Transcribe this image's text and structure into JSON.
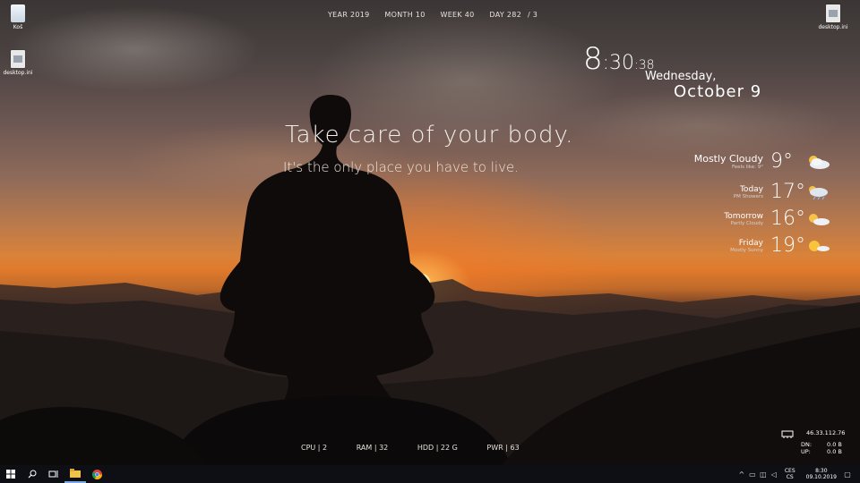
{
  "desktop": {
    "icons_left": [
      {
        "label": "Koš",
        "icon": "recycle-bin-icon"
      },
      {
        "label": "desktop.ini",
        "icon": "settings-file-icon"
      }
    ],
    "icons_right": [
      {
        "label": "desktop.ini",
        "icon": "settings-file-icon"
      }
    ]
  },
  "calendar_bar": {
    "year": "YEAR 2019",
    "month": "MONTH 10",
    "week": "WEEK 40",
    "day": "DAY 282",
    "day_suffix": "/ 3"
  },
  "clock": {
    "hour": "8",
    "minute": ":30",
    "seconds": ":38",
    "weekday": "Wednesday,",
    "date": "October 9"
  },
  "quote": {
    "line1": "Take care of your body.",
    "line2": "It's the only place you have to live."
  },
  "weather": [
    {
      "condition": "Mostly Cloudy",
      "sub": "Feels like: 9°",
      "temp": "9°",
      "icon": "mostly-cloudy-icon"
    },
    {
      "condition": "Today",
      "sub": "PM Showers",
      "temp": "17°",
      "icon": "showers-icon"
    },
    {
      "condition": "Tomorrow",
      "sub": "Partly Cloudy",
      "temp": "16°",
      "icon": "partly-cloudy-icon"
    },
    {
      "condition": "Friday",
      "sub": "Mostly Sunny",
      "temp": "19°",
      "icon": "mostly-sunny-icon"
    }
  ],
  "system": {
    "cpu": "CPU  |  2",
    "ram": "RAM  |  32",
    "hdd": "HDD  |  22 G",
    "pwr": "PWR  |  63"
  },
  "network": {
    "ip": "46.33.112.76",
    "dn_label": "DN:",
    "dn_value": "0.0 B",
    "up_label": "UP:",
    "up_value": "0.0 B"
  },
  "taskbar": {
    "language_top": "CES",
    "language_bottom": "CS",
    "time": "8:30",
    "date": "09.10.2019"
  },
  "colors": {
    "taskbar": "#0d0f14",
    "sun": "#ffd27a",
    "sky_orange": "#e07a2c"
  }
}
